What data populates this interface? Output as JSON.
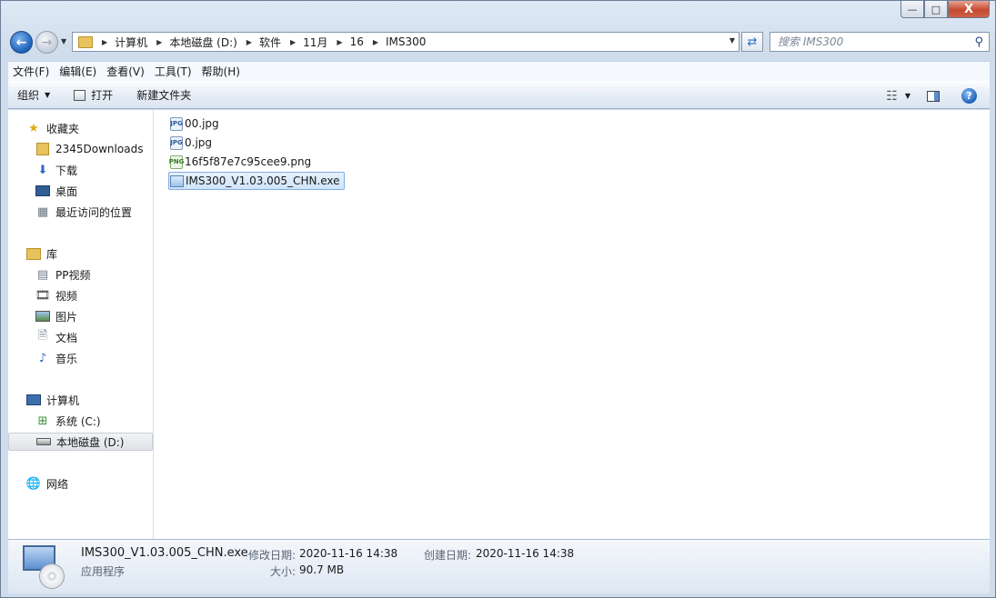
{
  "window": {
    "caption_buttons": {
      "minimize": "—",
      "maximize": "□",
      "close": "X"
    }
  },
  "address": {
    "breadcrumb": [
      "计算机",
      "本地磁盘 (D:)",
      "软件",
      "11月",
      "16",
      "IMS300"
    ]
  },
  "search": {
    "placeholder": "搜索 IMS300"
  },
  "menubar": [
    "文件(F)",
    "编辑(E)",
    "查看(V)",
    "工具(T)",
    "帮助(H)"
  ],
  "toolbar": {
    "organize": "组织",
    "open": "打开",
    "new_folder": "新建文件夹"
  },
  "nav": {
    "favorites": {
      "label": "收藏夹",
      "items": [
        "2345Downloads",
        "下载",
        "桌面",
        "最近访问的位置"
      ]
    },
    "libraries": {
      "label": "库",
      "items": [
        "PP视频",
        "视频",
        "图片",
        "文档",
        "音乐"
      ]
    },
    "computer": {
      "label": "计算机",
      "items": [
        "系统 (C:)",
        "本地磁盘 (D:)"
      ]
    },
    "network": {
      "label": "网络"
    }
  },
  "files": [
    {
      "name": "00.jpg",
      "type": "jpg",
      "badge": "JPG"
    },
    {
      "name": "0.jpg",
      "type": "jpg",
      "badge": "JPG"
    },
    {
      "name": "16f5f87e7c95cee9.png",
      "type": "png",
      "badge": "PNG"
    },
    {
      "name": "IMS300_V1.03.005_CHN.exe",
      "type": "exe",
      "badge": ""
    }
  ],
  "details": {
    "filename": "IMS300_V1.03.005_CHN.exe",
    "filetype": "应用程序",
    "modified_label": "修改日期:",
    "modified_value": "2020-11-16 14:38",
    "size_label": "大小:",
    "size_value": "90.7 MB",
    "created_label": "创建日期:",
    "created_value": "2020-11-16 14:38"
  },
  "colors": {
    "accent": "#1c5fb8",
    "selection": "#cfe4fb",
    "folder": "#e8c25a"
  }
}
